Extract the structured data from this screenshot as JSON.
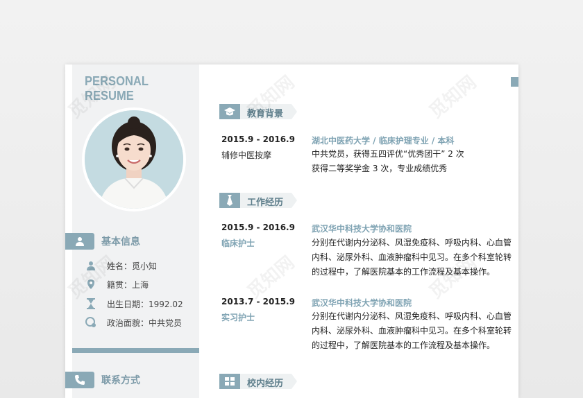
{
  "brand": {
    "title": "PERSONAL RESUME"
  },
  "watermark": "觅知网",
  "left": {
    "basic": {
      "title": "基本信息",
      "items": [
        {
          "icon": "user-icon",
          "text": "姓名：觅小知"
        },
        {
          "icon": "location-pin-icon",
          "text": "籍贯：上海"
        },
        {
          "icon": "hourglass-icon",
          "text": "出生日期：1992.02"
        },
        {
          "icon": "politics-icon",
          "text": "政治面貌：中共党员"
        }
      ]
    },
    "contact": {
      "title": "联系方式"
    }
  },
  "right": {
    "education": {
      "title": "教育背景",
      "date": "2015.9 - 2016.9",
      "sub": "辅修中医按摩",
      "org": "湖北中医药大学  /  临床护理专业  /  本科",
      "lines": [
        "中共党员，获得五四评优“优秀团干”   2  次",
        "获得二等奖学金 3 次，专业成绩优秀"
      ]
    },
    "work": {
      "title": "工作经历",
      "entries": [
        {
          "date": "2015.9 - 2016.9",
          "role": "临床护士",
          "org": "武汉华中科技大学协和医院",
          "lines": [
            "分别在代谢内分泌科、风湿免疫科、呼吸内科、心血管",
            "内科、泌尿外科、血液肿瘤科中见习。在多个科室轮转",
            "的过程中，了解医院基本的工作流程及基本操作。"
          ]
        },
        {
          "date": "2013.7 - 2015.9",
          "role": "实习护士",
          "org": "武汉华中科技大学协和医院",
          "lines": [
            "分别在代谢内分泌科、风湿免疫科、呼吸内科、心血管",
            "内科、泌尿外科、血液肿瘤科中见习。在多个科室轮转",
            "的过程中，了解医院基本的工作流程及基本操作。"
          ]
        }
      ]
    },
    "campus": {
      "title": "校内经历"
    }
  },
  "colors": {
    "accent": "#8aa9b6",
    "panel": "#f1f2f3",
    "label": "#7fa3b3"
  }
}
